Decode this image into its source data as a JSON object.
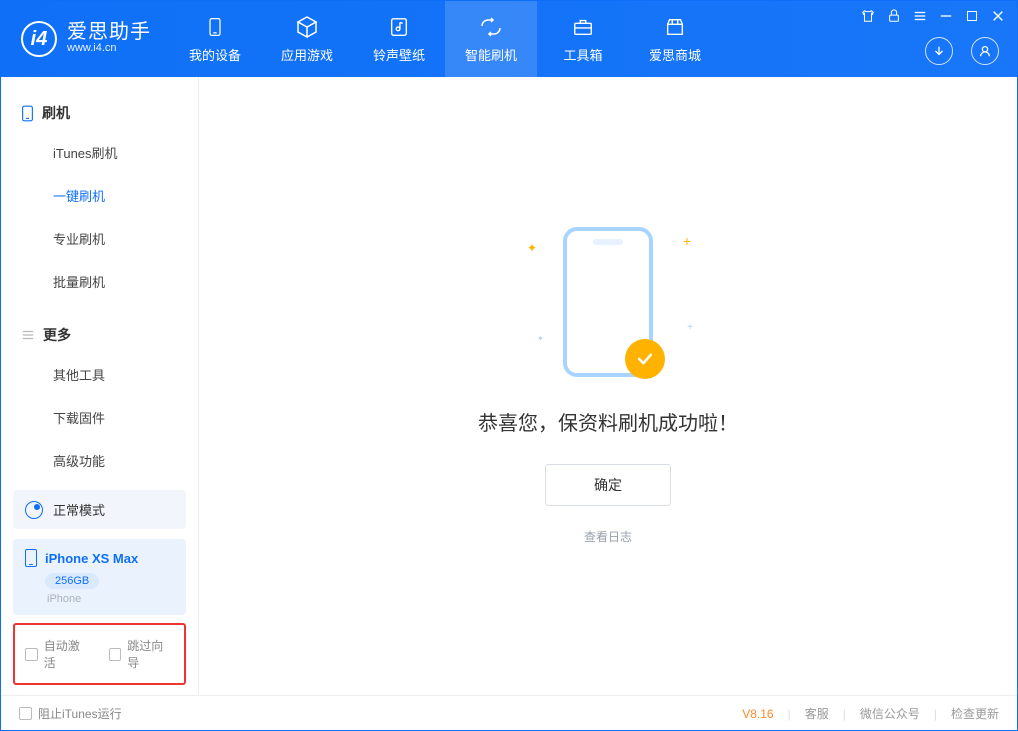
{
  "logo": {
    "cn": "爱思助手",
    "en": "www.i4.cn",
    "mark": "i4"
  },
  "nav": [
    {
      "label": "我的设备",
      "icon": "device"
    },
    {
      "label": "应用游戏",
      "icon": "cube"
    },
    {
      "label": "铃声壁纸",
      "icon": "music"
    },
    {
      "label": "智能刷机",
      "icon": "refresh",
      "active": true
    },
    {
      "label": "工具箱",
      "icon": "toolbox"
    },
    {
      "label": "爱思商城",
      "icon": "store"
    }
  ],
  "sidebar": {
    "group1": {
      "title": "刷机",
      "items": [
        "iTunes刷机",
        "一键刷机",
        "专业刷机",
        "批量刷机"
      ],
      "active_index": 1
    },
    "group2": {
      "title": "更多",
      "items": [
        "其他工具",
        "下载固件",
        "高级功能"
      ]
    }
  },
  "device": {
    "mode": "正常模式",
    "name": "iPhone XS Max",
    "capacity": "256GB",
    "type": "iPhone"
  },
  "options": {
    "auto_activate": "自动激活",
    "skip_guide": "跳过向导"
  },
  "main": {
    "success_text": "恭喜您，保资料刷机成功啦！",
    "ok_button": "确定",
    "log_link": "查看日志"
  },
  "footer": {
    "block_itunes": "阻止iTunes运行",
    "version": "V8.16",
    "links": [
      "客服",
      "微信公众号",
      "检查更新"
    ]
  }
}
